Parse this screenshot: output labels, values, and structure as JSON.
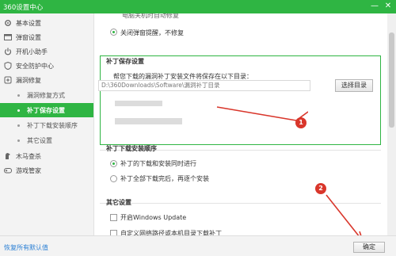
{
  "window": {
    "title": "360设置中心",
    "minimize": "—",
    "close": "✕"
  },
  "sidebar": {
    "items": [
      {
        "label": "基本设置",
        "icon": "gear-icon"
      },
      {
        "label": "弹窗设置",
        "icon": "popup-icon"
      },
      {
        "label": "开机小助手",
        "icon": "power-icon"
      },
      {
        "label": "安全防护中心",
        "icon": "shield-icon"
      },
      {
        "label": "漏洞修复",
        "icon": "patch-icon"
      }
    ],
    "subitems": [
      {
        "label": "漏洞修复方式"
      },
      {
        "label": "补丁保存设置"
      },
      {
        "label": "补丁下载安装顺序"
      },
      {
        "label": "其它设置"
      }
    ],
    "more_items": [
      {
        "label": "木马查杀",
        "icon": "trojan-icon"
      },
      {
        "label": "游戏管家",
        "icon": "gamepad-icon"
      }
    ]
  },
  "main": {
    "top_partial_text": "电脑关机时自动修复",
    "top_radio_label": "关闭弹窗提醒，不修复",
    "patch_save": {
      "title": "补丁保存设置",
      "instruction": "帮您下载的漏洞补丁安装文件将保存在以下目录：",
      "path_value": "D:\\360Downloads\\Software\\漏洞补丁目录",
      "choose_dir_button": "选择目录"
    },
    "download_order": {
      "title": "补丁下载安装顺序",
      "option1": "补丁的下载和安装同时进行",
      "option2": "补丁全部下载完后，再逐个安装"
    },
    "other": {
      "title": "其它设置",
      "check1": "开启Windows Update",
      "check2": "自定义网络路径或本机目录下载补丁"
    },
    "markers": [
      "1",
      "2"
    ]
  },
  "footer": {
    "restore_defaults": "恢复所有默认值",
    "confirm_button": "确定"
  },
  "colors": {
    "accent": "#2fb543",
    "marker": "#d9362b",
    "link": "#2a7fd4"
  }
}
